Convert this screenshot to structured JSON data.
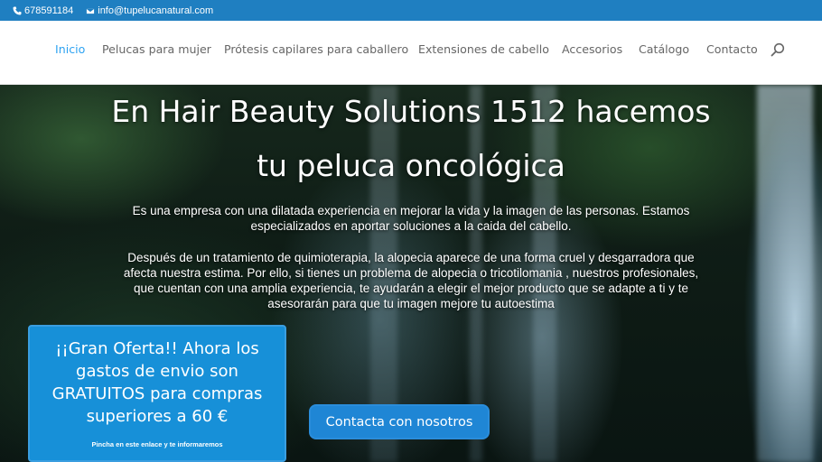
{
  "topbar": {
    "phone": "678591184",
    "email": "info@tupelucanatural.com"
  },
  "nav": {
    "items": [
      {
        "label": "Inicio",
        "active": true
      },
      {
        "label": "Pelucas para mujer",
        "active": false
      },
      {
        "label": "Prótesis capilares para caballero",
        "active": false
      },
      {
        "label": "Extensiones de cabello",
        "active": false
      },
      {
        "label": "Accesorios",
        "active": false
      },
      {
        "label": "Catálogo",
        "active": false
      },
      {
        "label": "Contacto",
        "active": false
      }
    ],
    "search_icon": "search-icon"
  },
  "hero": {
    "title_line1": "En Hair Beauty Solutions 1512 hacemos",
    "title_line2": "tu peluca oncológica",
    "para1_line1": "Es una empresa con una dilatada experiencia en mejorar la vida y la imagen de las personas. Estamos",
    "para1_line2": "especializados en aportar soluciones a la caida del cabello.",
    "para2_line1": "Después de un tratamiento de quimioterapia, la alopecia aparece de una forma cruel y desgarradora que",
    "para2_line2": "afecta nuestra estima. Por ello, si tienes un problema de alopecia o tricotilomania , nuestros profesionales,",
    "para2_line3": "que cuentan con una amplia experiencia, te ayudarán a elegir el mejor producto que se adapte a ti y te",
    "para2_line4": "asesorarán para que tu  imagen mejore tu autoestima",
    "cta_label": "Contacta con nosotros"
  },
  "offer": {
    "line1": "¡¡Gran Oferta!! Ahora los",
    "line2": "gastos de envio son",
    "line3": "GRATUITOS para compras",
    "line4": "superiores a 60 €",
    "link": "Pincha en este enlace y te informaremos"
  },
  "colors": {
    "topbar": "#1f7fc1",
    "accent": "#2ea3f2",
    "button": "#1f86d5"
  }
}
